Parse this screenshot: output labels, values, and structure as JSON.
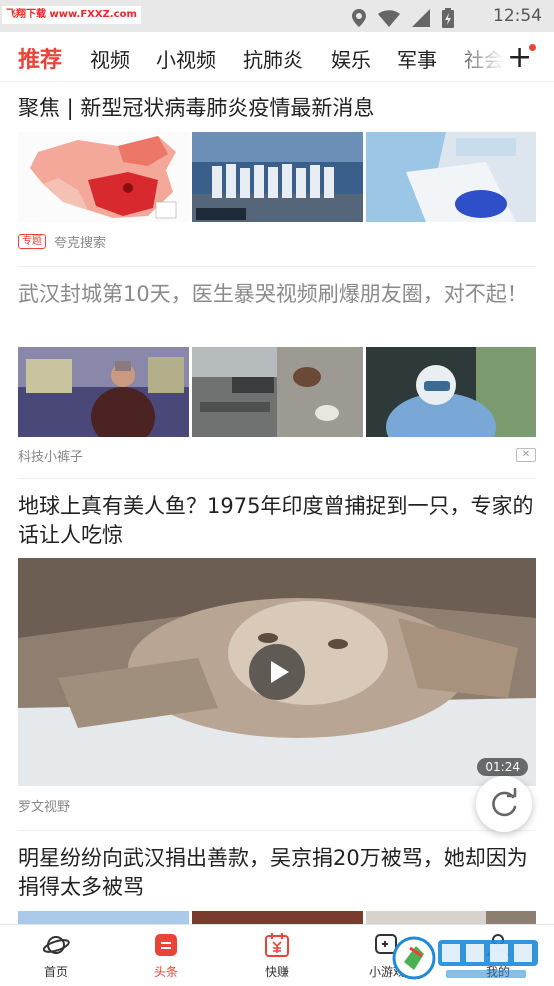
{
  "status_bar": {
    "watermark": "飞翔下载 www.FXXZ.com",
    "time": "12:54"
  },
  "tabs": {
    "items": [
      "推荐",
      "视频",
      "小视频",
      "抗肺炎",
      "娱乐",
      "军事",
      "社会"
    ],
    "active_index": 0
  },
  "feed": {
    "card1": {
      "title": "聚焦 | 新型冠状病毒肺炎疫情最新消息",
      "tag": "专题",
      "source": "夸克搜索"
    },
    "card2": {
      "title": "武汉封城第10天，医生暴哭视频刷爆朋友圈，对不起！",
      "source": "科技小裤子",
      "dismiss": "✕"
    },
    "card3": {
      "title": "地球上真有美人鱼？1975年印度曾捕捉到一只，专家的话让人吃惊",
      "duration": "01:24",
      "source": "罗文视野"
    },
    "card4": {
      "title": "明星纷纷向武汉捐出善款，吴京捐20万被骂，她却因为捐得太多被骂"
    }
  },
  "bottom_nav": {
    "items": [
      {
        "label": "首页",
        "icon": "planet-icon"
      },
      {
        "label": "头条",
        "icon": "headline-icon"
      },
      {
        "label": "快赚",
        "icon": "calendar-yuan-icon"
      },
      {
        "label": "小游戏",
        "icon": "gamepad-icon"
      },
      {
        "label": "我的",
        "icon": "person-icon"
      }
    ],
    "active_index": 1
  },
  "watermark_logo": {
    "brand": "飞翔下载",
    "url": "www.FXXZ.com"
  },
  "colors": {
    "accent": "#e8443a",
    "text": "#222222",
    "muted": "#888888"
  }
}
